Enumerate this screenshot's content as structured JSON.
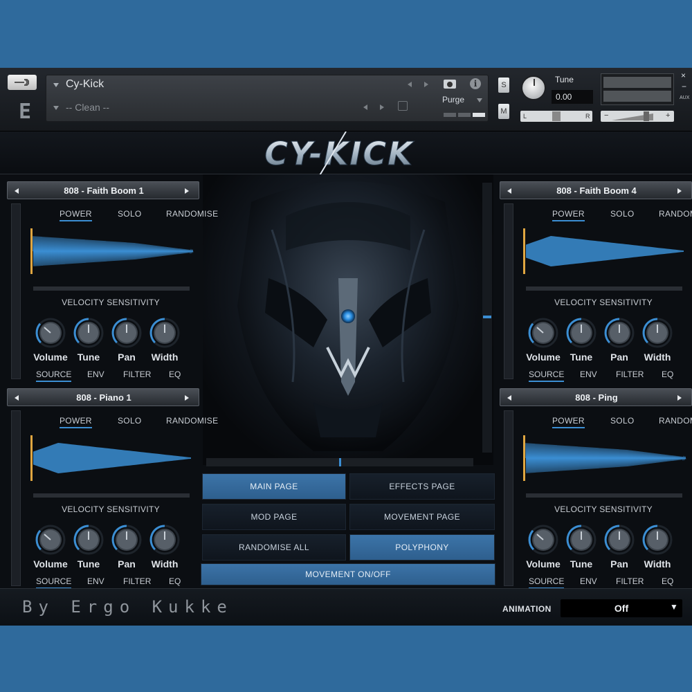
{
  "header": {
    "instrument_name": "Cy-Kick",
    "preset_name": "-- Clean --",
    "purge_label": "Purge",
    "info_glyph": "i",
    "solo_label": "S",
    "mute_label": "M",
    "tune_label": "Tune",
    "tune_value": "0.00",
    "pan_left": "L",
    "pan_right": "R",
    "vol_minus": "−",
    "vol_plus": "+",
    "close_glyph": "×",
    "minimize_glyph": "−",
    "aux_label": "AUX"
  },
  "slots": [
    {
      "name": "808 - Faith Boom 1",
      "tabs_top": [
        "POWER",
        "SOLO",
        "RANDOMISE"
      ],
      "velocity_label": "VELOCITY SENSITIVITY",
      "knobs": [
        "Volume",
        "Tune",
        "Pan",
        "Width"
      ],
      "tabs_bottom": [
        "SOURCE",
        "ENV",
        "FILTER",
        "EQ"
      ]
    },
    {
      "name": "808 - Faith Boom 4",
      "tabs_top": [
        "POWER",
        "SOLO",
        "RANDOMISE"
      ],
      "velocity_label": "VELOCITY SENSITIVITY",
      "knobs": [
        "Volume",
        "Tune",
        "Pan",
        "Width"
      ],
      "tabs_bottom": [
        "SOURCE",
        "ENV",
        "FILTER",
        "EQ"
      ]
    },
    {
      "name": "808 - Piano 1",
      "tabs_top": [
        "POWER",
        "SOLO",
        "RANDOMISE"
      ],
      "velocity_label": "VELOCITY SENSITIVITY",
      "knobs": [
        "Volume",
        "Tune",
        "Pan",
        "Width"
      ],
      "tabs_bottom": [
        "SOURCE",
        "ENV",
        "FILTER",
        "EQ"
      ]
    },
    {
      "name": "808 - Ping",
      "tabs_top": [
        "POWER",
        "SOLO",
        "RANDOMISE"
      ],
      "velocity_label": "VELOCITY SENSITIVITY",
      "knobs": [
        "Volume",
        "Tune",
        "Pan",
        "Width"
      ],
      "tabs_bottom": [
        "SOURCE",
        "ENV",
        "FILTER",
        "EQ"
      ]
    }
  ],
  "pages": {
    "main": "MAIN PAGE",
    "effects": "EFFECTS PAGE",
    "mod": "MOD PAGE",
    "movement": "MOVEMENT PAGE",
    "randomise_all": "RANDOMISE ALL",
    "polyphony": "POLYPHONY",
    "movement_toggle": "MOVEMENT ON/OFF"
  },
  "footer": {
    "signature": "By Ergo Kukke",
    "animation_label": "ANIMATION",
    "animation_value": "Off",
    "caret": "▼"
  },
  "logo_text": "CY-KICK",
  "colors": {
    "accent": "#3b8ed3",
    "page_bg": "#2f6a9c",
    "active_button": "#3c74a8"
  }
}
